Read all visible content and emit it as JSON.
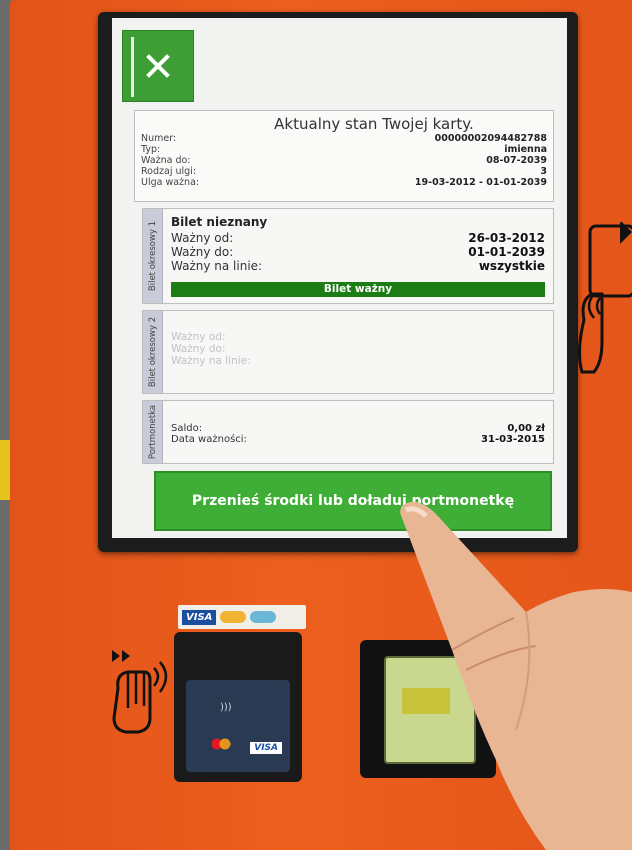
{
  "screen": {
    "close_label": "×",
    "card_status": {
      "title": "Aktualny stan Twojej karty.",
      "rows": [
        {
          "label": "Numer:",
          "value": "00000002094482788"
        },
        {
          "label": "Typ:",
          "value": "imienna"
        },
        {
          "label": "Ważna do:",
          "value": "08-07-2039"
        },
        {
          "label": "Rodzaj ulgi:",
          "value": "3"
        },
        {
          "label": "Ulga ważna:",
          "value": "19-03-2012 - 01-01-2039"
        }
      ]
    },
    "ticket1": {
      "tab_label": "Bilet okresowy 1",
      "name": "Bilet nieznany",
      "rows": [
        {
          "label": "Ważny od:",
          "value": "26-03-2012"
        },
        {
          "label": "Ważny do:",
          "value": "01-01-2039"
        },
        {
          "label": "Ważny na linie:",
          "value": "wszystkie"
        }
      ],
      "status": "Bilet ważny"
    },
    "ticket2": {
      "tab_label": "Bilet okresowy 2",
      "rows": [
        {
          "label": "Ważny od:"
        },
        {
          "label": "Ważny do:"
        },
        {
          "label": "Ważny na linie:"
        }
      ]
    },
    "wallet": {
      "tab_label": "Portmonetka",
      "rows": [
        {
          "label": "Saldo:",
          "value": "0,00 zł"
        },
        {
          "label": "Data ważności:",
          "value": "31-03-2015"
        }
      ]
    },
    "action_button": "Przenieś środki lub doładuj portmonetkę"
  },
  "hardware": {
    "visa_label": "VISA",
    "pos_visa_label": "VISA"
  },
  "colors": {
    "machine_orange": "#e2531a",
    "primary_green": "#3fae37",
    "valid_green": "#1d7d15"
  }
}
